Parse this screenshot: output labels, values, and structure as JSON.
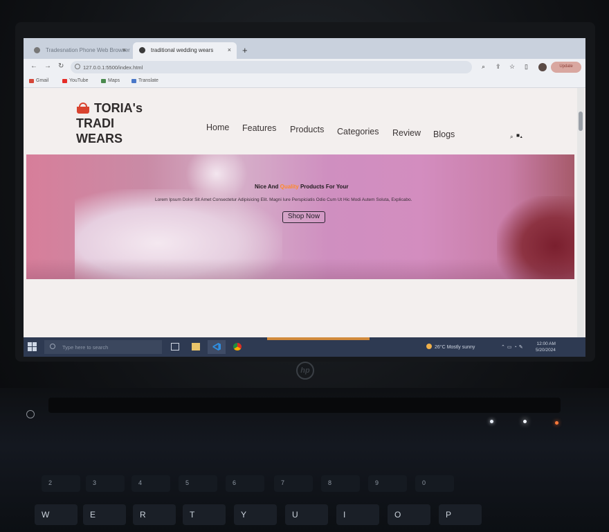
{
  "browser": {
    "tabs": [
      {
        "label": "Tradesnation Phone Web Browser",
        "active": false
      },
      {
        "label": "traditional wedding wears",
        "active": true
      }
    ],
    "new_tab": "+",
    "close_glyph": "×",
    "url": "127.0.0.1:5500/index.html",
    "update_label": "Update",
    "bookmarks": [
      {
        "label": "Gmail",
        "color": "#d44638"
      },
      {
        "label": "YouTube",
        "color": "#e52d27"
      },
      {
        "label": "Maps",
        "color": "#4a8a4e"
      },
      {
        "label": "Translate",
        "color": "#4a78c8"
      }
    ]
  },
  "site": {
    "logo_lines": [
      "TORIA's",
      "TRADI",
      "WEARS"
    ],
    "nav": [
      "Home",
      "Features",
      "Products",
      "Categories",
      "Review",
      "Blogs"
    ],
    "header_icons": [
      "search-icon",
      "cart-icon",
      "user-icon"
    ],
    "hero": {
      "title_before": "Nice And ",
      "title_accent": "Quality",
      "title_after": " Products For Your",
      "subtitle": "Lorem Ipsum Dolor Sit Amet Consectetur Adipisicing Elit. Magni Iure Perspiciatis Odio Cum Ut Hic Modi Autem Soluta, Explicabo.",
      "button": "Shop Now",
      "accent_color": "#ff8a2a"
    }
  },
  "taskbar": {
    "search_placeholder": "Type here to search",
    "weather": "26°C  Mostly sunny",
    "time": "12:00 AM",
    "date": "5/20/2024",
    "apps": [
      "task-view-icon",
      "file-explorer-icon",
      "vscode-icon",
      "chrome-icon"
    ]
  },
  "hardware": {
    "brand": "hp",
    "keys_row_numbers": [
      "2",
      "3",
      "4",
      "5",
      "6",
      "7",
      "8",
      "9",
      "0"
    ],
    "keys_row_letters": [
      "W",
      "E",
      "R",
      "T",
      "Y",
      "U",
      "I",
      "O",
      "P"
    ]
  }
}
